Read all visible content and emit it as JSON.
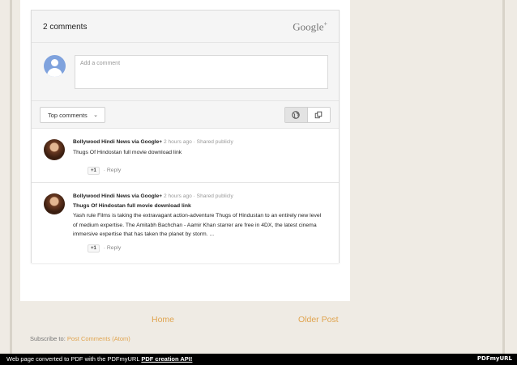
{
  "comments_widget": {
    "count_label": "2 comments",
    "brand": "Google",
    "brand_plus": "+",
    "composer_placeholder": "Add a comment",
    "sort_label": "Top comments",
    "sort_chevron_icon": "chevron-down-icon",
    "view_icons": [
      "globe-icon",
      "copy-icon"
    ]
  },
  "comments": [
    {
      "author": "Bollywood Hindi News",
      "via": " via Google+",
      "time": "2 hours ago",
      "separator": "·",
      "visibility": "Shared publicly",
      "title": "Thugs Of Hindostan full movie download link",
      "body": "",
      "plus_one": "+1",
      "reply_label": "Reply"
    },
    {
      "author": "Bollywood Hindi News",
      "via": " via Google+",
      "time": "2 hours ago",
      "separator": "·",
      "visibility": "Shared publicly",
      "title": "Thugs Of Hindostan full movie download link",
      "body": "Yash rule Films is taking the extravagant action-adventure Thugs of Hindustan to an entirely new level of medium expertise. The Amitabh Bachchan - Aamir Khan starrer are free in 4DX, the latest cinema immersive expertise that has taken the planet by storm. ...",
      "plus_one": "+1",
      "reply_label": "Reply"
    }
  ],
  "pager": {
    "home": "Home",
    "older": "Older Post"
  },
  "subscribe": {
    "label": "Subscribe to: ",
    "link": "Post Comments (Atom)"
  },
  "footer": {
    "text": "Web page converted to PDF with the PDFmyURL ",
    "api_link": "PDF creation API!",
    "logo": "PDFmyURL"
  }
}
